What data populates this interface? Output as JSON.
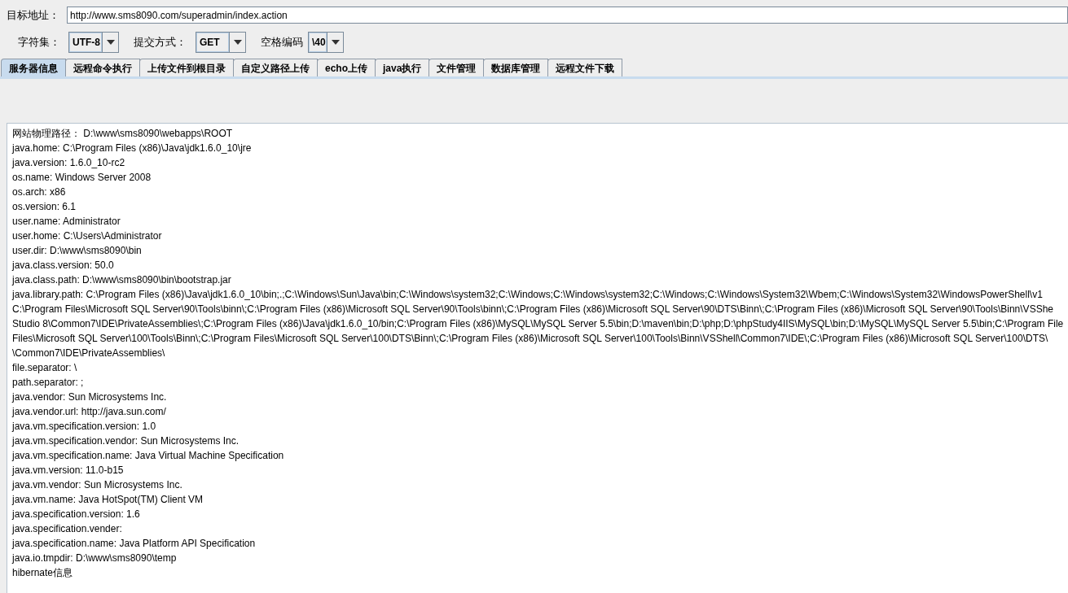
{
  "address": {
    "label": "目标地址：",
    "value": "http://www.sms8090.com/superadmin/index.action"
  },
  "options": [
    {
      "label": "字符集：",
      "value": "UTF-8"
    },
    {
      "label": "提交方式：",
      "value": "GET"
    },
    {
      "label": "空格编码",
      "value": "\\40"
    }
  ],
  "tabs": [
    {
      "label": "服务器信息",
      "selected": true
    },
    {
      "label": "远程命令执行",
      "selected": false
    },
    {
      "label": "上传文件到根目录",
      "selected": false
    },
    {
      "label": "自定义路径上传",
      "selected": false
    },
    {
      "label": "echo上传",
      "selected": false
    },
    {
      "label": "java执行",
      "selected": false
    },
    {
      "label": "文件管理",
      "selected": false
    },
    {
      "label": "数据库管理",
      "selected": false
    },
    {
      "label": "远程文件下载",
      "selected": false
    }
  ],
  "output_lines": [
    "网站物理路径：  D:\\www\\sms8090\\webapps\\ROOT",
    "java.home: C:\\Program Files (x86)\\Java\\jdk1.6.0_10\\jre",
    "java.version: 1.6.0_10-rc2",
    "os.name: Windows Server 2008",
    "os.arch: x86",
    "os.version: 6.1",
    "user.name: Administrator",
    "user.home: C:\\Users\\Administrator",
    "user.dir: D:\\www\\sms8090\\bin",
    "java.class.version: 50.0",
    "java.class.path: D:\\www\\sms8090\\bin\\bootstrap.jar",
    "java.library.path: C:\\Program Files (x86)\\Java\\jdk1.6.0_10\\bin;.;C:\\Windows\\Sun\\Java\\bin;C:\\Windows\\system32;C:\\Windows;C:\\Windows\\system32;C:\\Windows;C:\\Windows\\System32\\Wbem;C:\\Windows\\System32\\WindowsPowerShell\\v1",
    "C:\\Program Files\\Microsoft SQL Server\\90\\Tools\\binn\\;C:\\Program Files (x86)\\Microsoft SQL Server\\90\\Tools\\binn\\;C:\\Program Files (x86)\\Microsoft SQL Server\\90\\DTS\\Binn\\;C:\\Program Files (x86)\\Microsoft SQL Server\\90\\Tools\\Binn\\VSShe",
    "Studio 8\\Common7\\IDE\\PrivateAssemblies\\;C:\\Program Files (x86)\\Java\\jdk1.6.0_10/bin;C:\\Program Files (x86)\\MySQL\\MySQL Server 5.5\\bin;D:\\maven\\bin;D:\\php;D:\\phpStudy4IIS\\MySQL\\bin;D:\\MySQL\\MySQL Server 5.5\\bin;C:\\Program File",
    "Files\\Microsoft SQL Server\\100\\Tools\\Binn\\;C:\\Program Files\\Microsoft SQL Server\\100\\DTS\\Binn\\;C:\\Program Files (x86)\\Microsoft SQL Server\\100\\Tools\\Binn\\VSShell\\Common7\\IDE\\;C:\\Program Files (x86)\\Microsoft SQL Server\\100\\DTS\\",
    "\\Common7\\IDE\\PrivateAssemblies\\",
    "file.separator: \\",
    "path.separator: ;",
    "java.vendor: Sun Microsystems Inc.",
    "java.vendor.url: http://java.sun.com/",
    "java.vm.specification.version: 1.0",
    "java.vm.specification.vendor: Sun Microsystems Inc.",
    "java.vm.specification.name: Java Virtual Machine Specification",
    "java.vm.version: 11.0-b15",
    "java.vm.vendor: Sun Microsystems Inc.",
    "java.vm.name: Java HotSpot(TM) Client VM",
    "java.specification.version: 1.6",
    "java.specification.vender:",
    "java.specification.name: Java Platform API Specification",
    "java.io.tmpdir: D:\\www\\sms8090\\temp",
    "hibernate信息"
  ]
}
